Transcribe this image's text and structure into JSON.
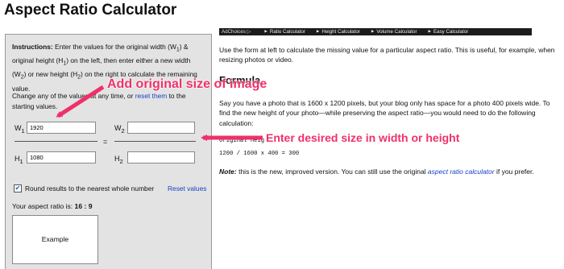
{
  "title": "Aspect Ratio Calculator",
  "calculator": {
    "instructions_bold": "Instructions:",
    "instructions_line1": " Enter the values for the original width (W",
    "instructions_w1_sub": "1",
    "instructions_line1b": ") &",
    "instructions_line2": "original height (H",
    "instructions_h1_sub": "1",
    "instructions_line2b": ") on the left, then enter either a new width",
    "instructions_line3": "(W",
    "instructions_w2_sub": "2",
    "instructions_line3b": ") or new height (H",
    "instructions_h2_sub": "2",
    "instructions_line3c": ") on the right to calculate the remaining",
    "instructions_line4": "value.",
    "change_prefix": "Change any of the values at any time, or ",
    "reset_them": "reset them",
    "change_suffix": " to the",
    "change_line2": "starting values.",
    "w1_label": "W",
    "w1_sub": "1",
    "w1_value": "1920",
    "h1_label": "H",
    "h1_sub": "1",
    "h1_value": "1080",
    "w2_label": "W",
    "w2_sub": "2",
    "w2_value": "",
    "h2_label": "H",
    "h2_sub": "2",
    "h2_value": "",
    "equals": "=",
    "round_checked": true,
    "round_label": "Round results to the nearest whole number",
    "reset_values": "Reset values",
    "ratio_prefix": "Your aspect ratio is: ",
    "ratio_value": "16 : 9",
    "example_label": "Example"
  },
  "navbar": {
    "adchoices": "AdChoices ▷",
    "items": [
      "Ratio Calculator",
      "Height Calculator",
      "Volume Calculator",
      "Easy Calculator"
    ]
  },
  "content": {
    "intro": "Use the form at left to calculate the missing value for a particular aspect ratio. This is useful, for example, when resizing photos or video.",
    "formula_title": "Formula",
    "description": "Say you have a photo that is 1600 x 1200 pixels, but your blog only has space for a photo 400 pixels wide. To find the new height of your photo—while preserving the aspect ratio—you would need to do the following calculation:",
    "code_line1": "original heig",
    "code_line2": "1200 / 1600 x 400 = 300",
    "note_bold": "Note:",
    "note_text": " this is the new, improved version. You can still use the original ",
    "note_link": "aspect ratio calculator",
    "note_suffix": " if you prefer."
  },
  "annotations": {
    "add_original": "Add original size of image",
    "enter_desired": "Enter desired size in width or height",
    "color": "#f0306a"
  }
}
